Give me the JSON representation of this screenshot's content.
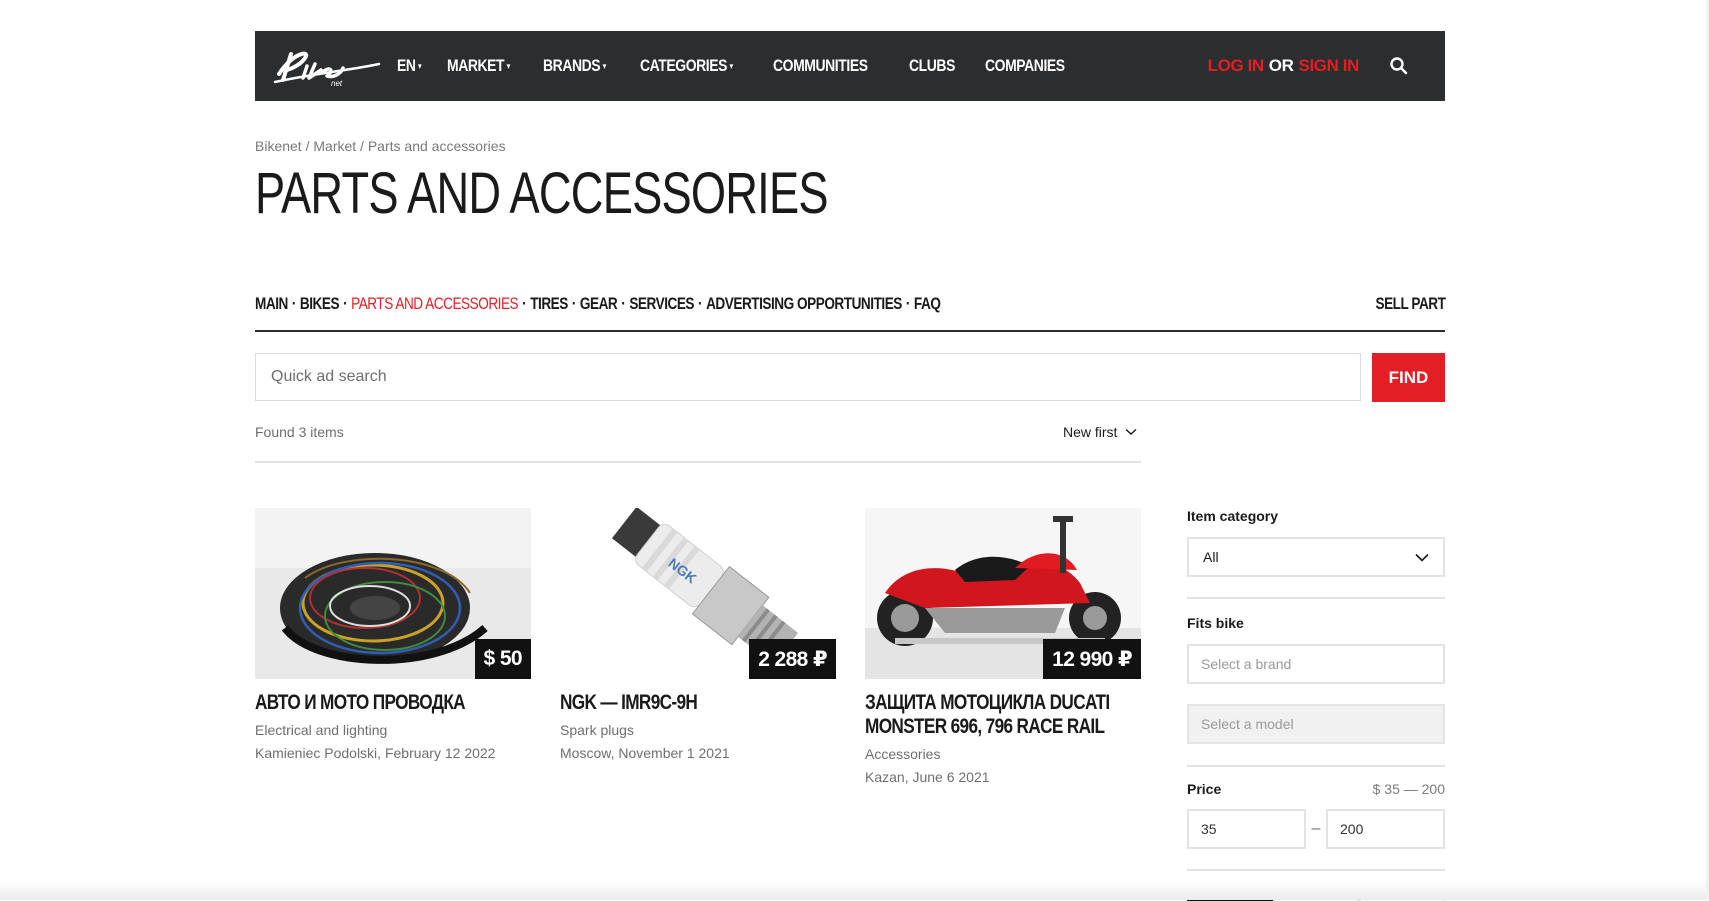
{
  "header": {
    "nav": [
      {
        "label": "EN",
        "dropdown": true
      },
      {
        "label": "MARKET",
        "dropdown": true
      },
      {
        "label": "BRANDS",
        "dropdown": true
      },
      {
        "label": "CATEGORIES",
        "dropdown": true
      },
      {
        "label": "COMMUNITIES",
        "dropdown": false
      },
      {
        "label": "CLUBS",
        "dropdown": false
      },
      {
        "label": "COMPANIES",
        "dropdown": false
      }
    ],
    "login": "LOG IN",
    "or": "OR",
    "signin": "SIGN IN",
    "search_icon": "search-icon"
  },
  "breadcrumb": [
    "Bikenet",
    "Market",
    "Parts and accessories"
  ],
  "breadcrumb_sep": " / ",
  "title": "PARTS AND ACCESSORIES",
  "subnav": {
    "items": [
      "MAIN",
      "BIKES",
      "PARTS AND ACCESSORIES",
      "TIRES",
      "GEAR",
      "SERVICES",
      "ADVERTISING OPPORTUNITIES",
      "FAQ"
    ],
    "active": "PARTS AND ACCESSORIES",
    "sell": "SELL PART"
  },
  "search": {
    "placeholder": "Quick ad search",
    "button": "FIND"
  },
  "results": {
    "found": "Found 3 items",
    "sort": "New first"
  },
  "listings": [
    {
      "price": "$ 50",
      "title": "АВТО И МОТО ПРОВОДКА",
      "category": "Electrical and lighting",
      "location": "Kamieniec Podolski, February 12 2022"
    },
    {
      "price": "2 288 ₽",
      "title": "NGK — IMR9C-9H",
      "category": "Spark plugs",
      "location": "Moscow, November 1 2021"
    },
    {
      "price": "12 990 ₽",
      "title": "ЗАЩИТА МОТОЦИКЛА DUCATI MONSTER 696, 796 RACE RAIL",
      "category": "Accessories",
      "location": "Kazan, June 6 2021"
    }
  ],
  "filters": {
    "category_label": "Item category",
    "category_value": "All",
    "fits_label": "Fits bike",
    "brand_placeholder": "Select a brand",
    "model_placeholder": "Select a model",
    "price_label": "Price",
    "price_range": "$ 35 — 200",
    "price_min": "35",
    "price_max": "200",
    "price_dash": "–"
  },
  "colors": {
    "accent": "#e31e24",
    "dark": "#2b2d2f"
  }
}
